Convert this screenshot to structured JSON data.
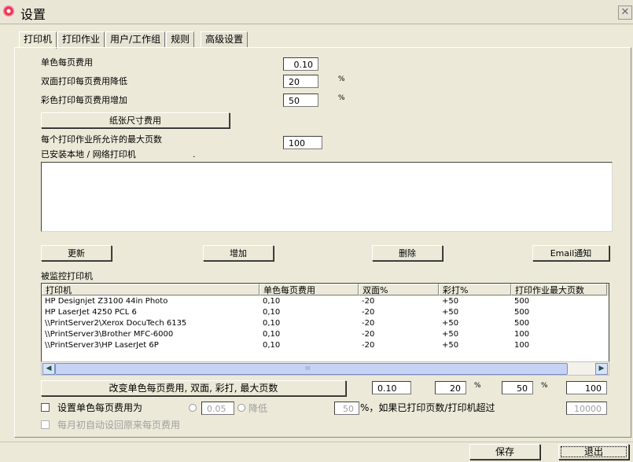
{
  "window": {
    "title": "设置",
    "close": "✕"
  },
  "tabs": [
    "打印机",
    "打印作业",
    "用户/工作组",
    "规则",
    "高级设置"
  ],
  "settings": {
    "mono_cost_label": "单色每页费用",
    "mono_cost_value": "0.10",
    "duplex_label": "双面打印每页费用降低",
    "duplex_value": "20",
    "duplex_unit": "%",
    "color_label": "彩色打印每页费用增加",
    "color_value": "50",
    "color_unit": "%",
    "paper_size_button": "纸张尺寸费用",
    "max_pages_label": "每个打印作业所允许的最大页数",
    "max_pages_value": "100",
    "installed_label": "已安装本地 / 网络打印机",
    "installed_dot": "."
  },
  "actions": {
    "update": "更新",
    "add": "增加",
    "delete": "删除",
    "email": "Email通知"
  },
  "monitored": {
    "label": "被监控打印机",
    "columns": [
      "打印机",
      "单色每页费用",
      "双面%",
      "彩打%",
      "打印作业最大页数"
    ],
    "rows": [
      [
        "HP Designjet Z3100 44in Photo",
        "0,10",
        "-20",
        "+50",
        "500"
      ],
      [
        "HP LaserJet 4250 PCL 6",
        "0,10",
        "-20",
        "+50",
        "500"
      ],
      [
        "\\\\PrintServer2\\Xerox DocuTech 6135",
        "0,10",
        "-20",
        "+50",
        "500"
      ],
      [
        "\\\\PrintServer3\\Brother MFC-6000",
        "0,10",
        "-20",
        "+50",
        "100"
      ],
      [
        "\\\\PrintServer3\\HP LaserJet 6P",
        "0,10",
        "-20",
        "+50",
        "100"
      ]
    ],
    "scroll_thumb_grip": "III"
  },
  "change_row": {
    "button": "改变单色每页费用, 双面, 彩打, 最大页数",
    "mono": "0.10",
    "duplex": "20",
    "duplex_unit": "%",
    "color": "50",
    "color_unit": "%",
    "max": "100"
  },
  "set_row": {
    "label": "设置单色每页费用为",
    "value": "0.05",
    "lower_label": "降低",
    "lower_value": "50",
    "suffix": "%，如果已打印页数/打印机超过",
    "threshold": "10000"
  },
  "monthly_reset": "每月初自动设回原来每页费用",
  "footer": {
    "save": "保存",
    "exit": "退出"
  }
}
